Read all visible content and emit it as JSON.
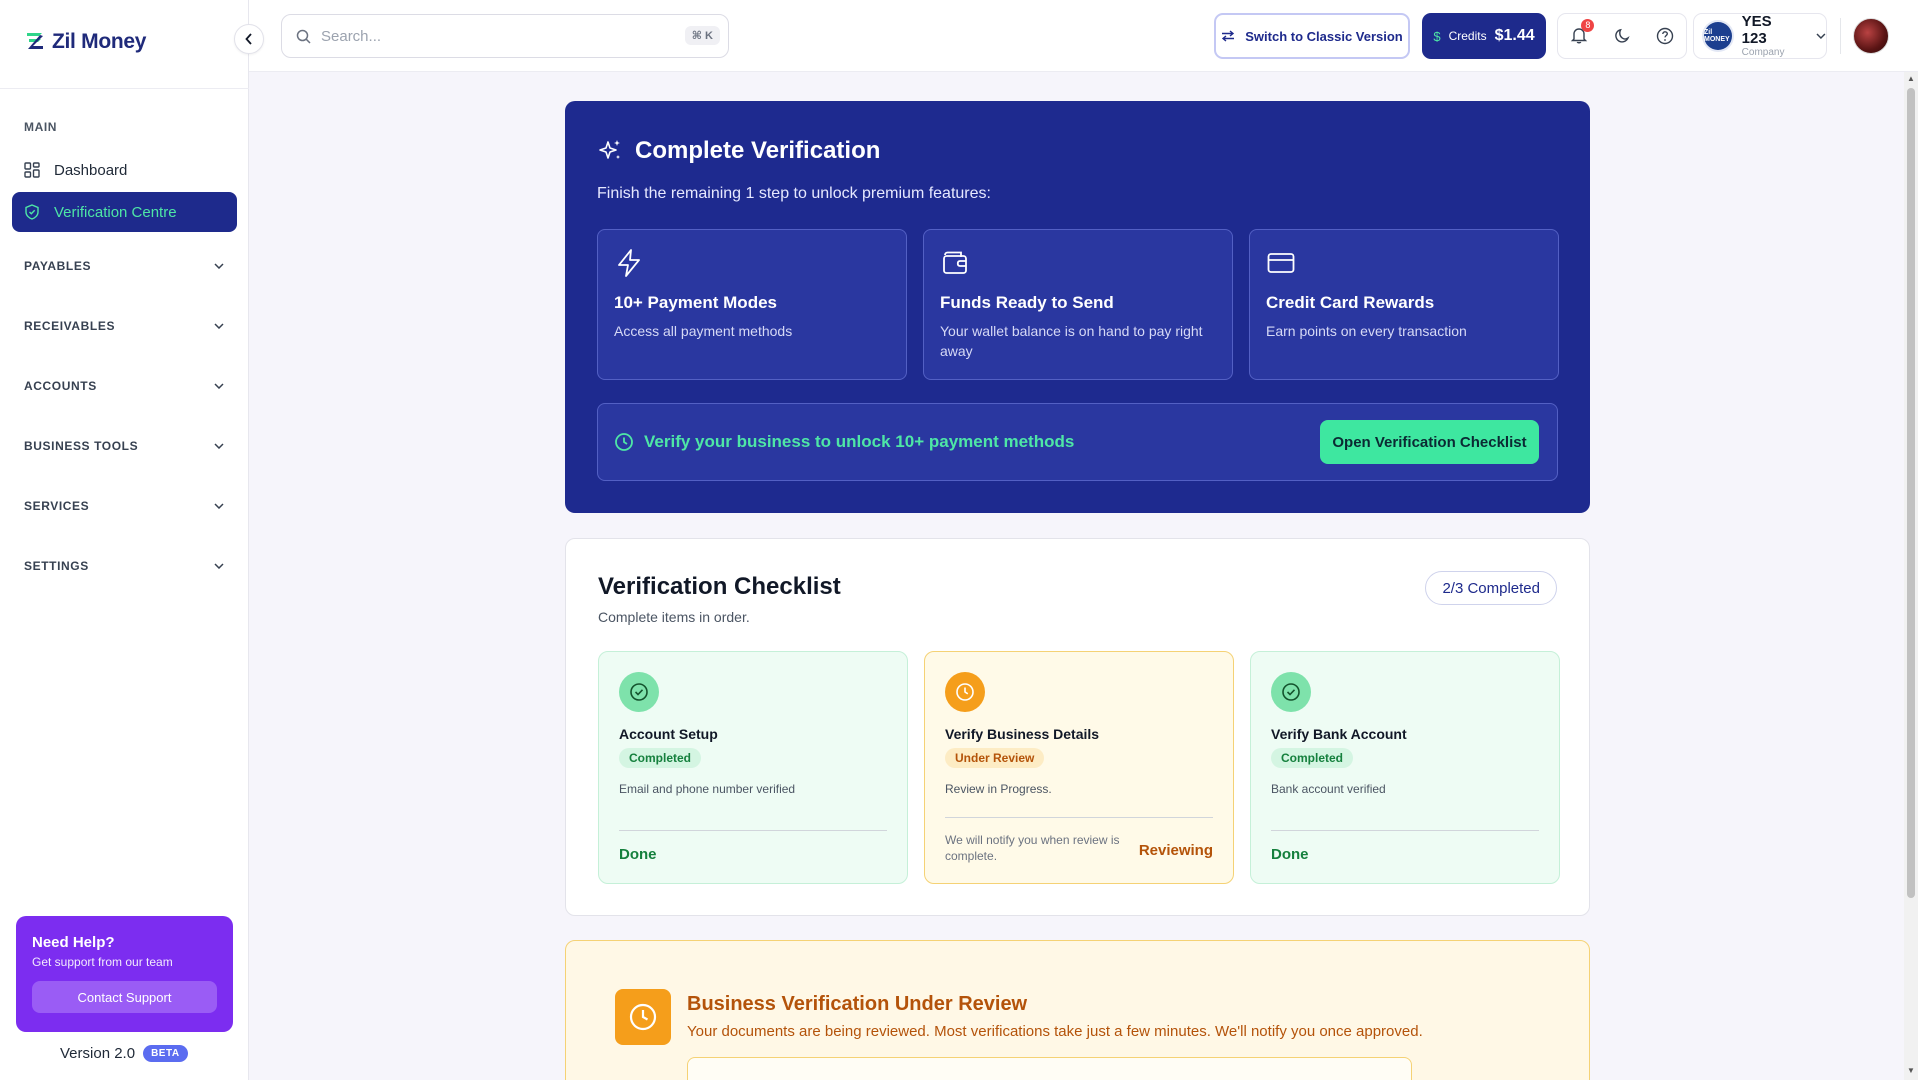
{
  "brand": {
    "name": "Zil Money"
  },
  "sidebar": {
    "main_label": "MAIN",
    "items": [
      {
        "label": "Dashboard"
      },
      {
        "label": "Verification Centre"
      }
    ],
    "groups": [
      {
        "label": "PAYABLES"
      },
      {
        "label": "RECEIVABLES"
      },
      {
        "label": "ACCOUNTS"
      },
      {
        "label": "BUSINESS TOOLS"
      },
      {
        "label": "SERVICES"
      },
      {
        "label": "SETTINGS"
      }
    ],
    "help": {
      "title": "Need Help?",
      "subtitle": "Get support from our team",
      "button": "Contact Support"
    },
    "version": "Version 2.0",
    "beta": "BETA"
  },
  "topbar": {
    "search_placeholder": "Search...",
    "search_shortcut": "⌘ K",
    "switch_label": "Switch to Classic Version",
    "credits_label": "Credits",
    "credits_symbol": "$",
    "credits_amount": "$1.44",
    "notification_count": "8",
    "company_name": "YES 123",
    "company_type": "Company",
    "company_logo_text": "Zil MONEY"
  },
  "hero": {
    "title": "Complete Verification",
    "subtitle": "Finish the remaining 1 step to unlock premium features:",
    "features": [
      {
        "icon": "lightning-icon",
        "title": "10+ Payment Modes",
        "desc": "Access all payment methods"
      },
      {
        "icon": "wallet-icon",
        "title": "Funds Ready to Send",
        "desc": "Your wallet balance is on hand to pay right away"
      },
      {
        "icon": "credit-card-icon",
        "title": "Credit Card Rewards",
        "desc": "Earn points on every transaction"
      }
    ],
    "unlock_text": "Verify your business to unlock 10+ payment methods",
    "checklist_button": "Open Verification Checklist"
  },
  "checklist": {
    "title": "Verification Checklist",
    "subtitle": "Complete items in order.",
    "progress": "2/3 Completed",
    "steps": [
      {
        "title": "Account Setup",
        "status": "Completed",
        "desc": "Email and phone number verified",
        "footer": "Done"
      },
      {
        "title": "Verify Business Details",
        "status": "Under Review",
        "desc": "Review in Progress.",
        "note": "We will notify you when review is complete.",
        "footer": "Reviewing"
      },
      {
        "title": "Verify Bank Account",
        "status": "Completed",
        "desc": "Bank account verified",
        "footer": "Done"
      }
    ]
  },
  "banner": {
    "title": "Business Verification Under Review",
    "subtitle": "Your documents are being reviewed. Most verifications take just a few minutes. We'll notify you once approved."
  },
  "colors": {
    "brand_navy": "#1e2a8f",
    "accent_green": "#3ee7a0",
    "review_orange": "#f59e1b",
    "help_purple": "#7c2df0"
  }
}
